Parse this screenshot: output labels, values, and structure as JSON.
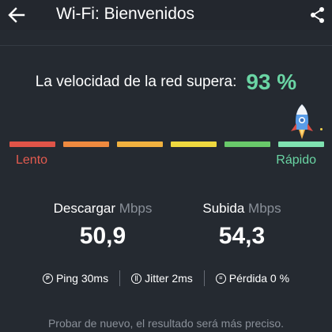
{
  "header": {
    "title": "Wi-Fi: Bienvenidos",
    "back_icon": "arrow-left-icon",
    "share_icon": "share-icon"
  },
  "result": {
    "text": "La velocidad de la red supera:",
    "value": "93 %",
    "accent_color": "#6ad5a4"
  },
  "speed_scale": {
    "segment_colors": [
      "#e05448",
      "#ef8a3f",
      "#f1b13f",
      "#efd83f",
      "#69c96a",
      "#7fe1b0"
    ],
    "slow_label": "Lento",
    "fast_label": "Rápido",
    "slow_color": "#e45b4f",
    "fast_color": "#6ad5a4",
    "marker_icon": "rocket-icon"
  },
  "stats": {
    "download": {
      "label": "Descargar",
      "unit": "Mbps",
      "value": "50,9"
    },
    "upload": {
      "label": "Subida",
      "unit": "Mbps",
      "value": "54,3"
    }
  },
  "metrics": [
    {
      "icon": "ping-icon",
      "text": "Ping 30ms"
    },
    {
      "icon": "jitter-icon",
      "text": "Jitter 2ms"
    },
    {
      "icon": "loss-icon",
      "text": "Pérdida 0 %"
    }
  ],
  "footer": {
    "text": "Probar de nuevo, el resultado será más preciso."
  }
}
